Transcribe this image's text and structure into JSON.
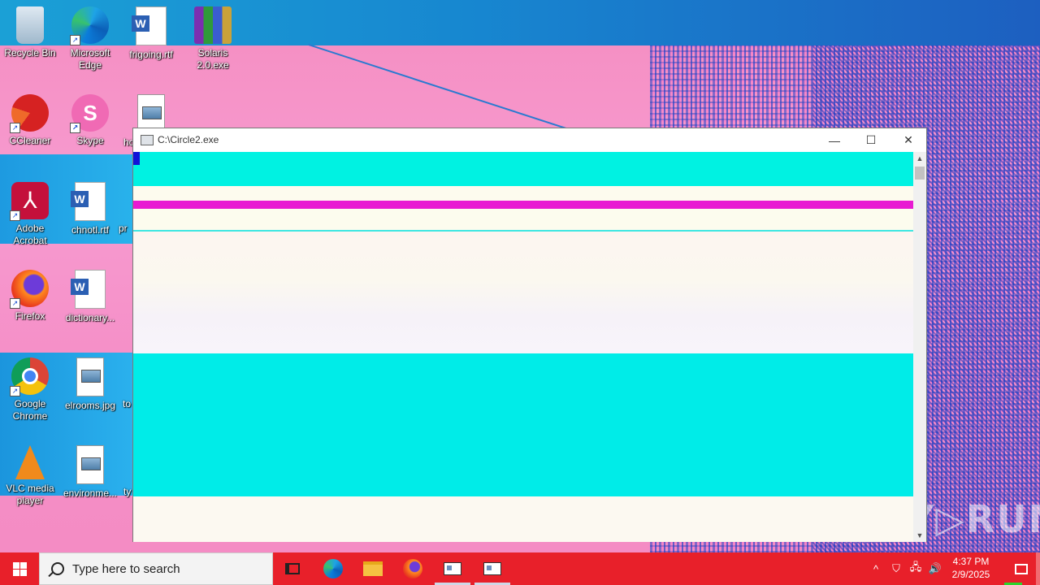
{
  "desktop": {
    "icons": [
      {
        "label": "Recycle Bin"
      },
      {
        "label": "Microsoft Edge"
      },
      {
        "label": "frigoing.rtf"
      },
      {
        "label": "Solaris 2.0.exe"
      },
      {
        "label": "CCleaner"
      },
      {
        "label": "Skype"
      },
      {
        "label": "hc"
      },
      {
        "label": "Adobe Acrobat"
      },
      {
        "label": "chnotl.rtf"
      },
      {
        "label": "Firefox"
      },
      {
        "label": "dictionary..."
      },
      {
        "label": "pr"
      },
      {
        "label": "Google Chrome"
      },
      {
        "label": "elrooms.jpg"
      },
      {
        "label": "to"
      },
      {
        "label": "VLC media player"
      },
      {
        "label": "environme..."
      },
      {
        "label": "ty"
      }
    ]
  },
  "window": {
    "title": "C:\\Circle2.exe",
    "minimize": "—",
    "maximize": "☐",
    "close": "✕",
    "scroll_up": "▲",
    "scroll_down": "▼",
    "colors": {
      "cyan": "#00f2e2",
      "magenta": "#e81ad2",
      "blue_marker": "#1212d8",
      "light": "#fdf8ef"
    }
  },
  "watermark": "ANY▷RUN",
  "taskbar": {
    "search_placeholder": "Type here to search",
    "clock_time": "4:37 PM",
    "clock_date": "2/9/2025",
    "icons": [
      "task-view-icon",
      "edge-icon",
      "file-explorer-icon",
      "firefox-icon",
      "app-window-icon",
      "app-window-icon"
    ],
    "tray": {
      "chevron": "^",
      "security": "⛉",
      "network": "🖧",
      "volume": "🔊"
    }
  }
}
